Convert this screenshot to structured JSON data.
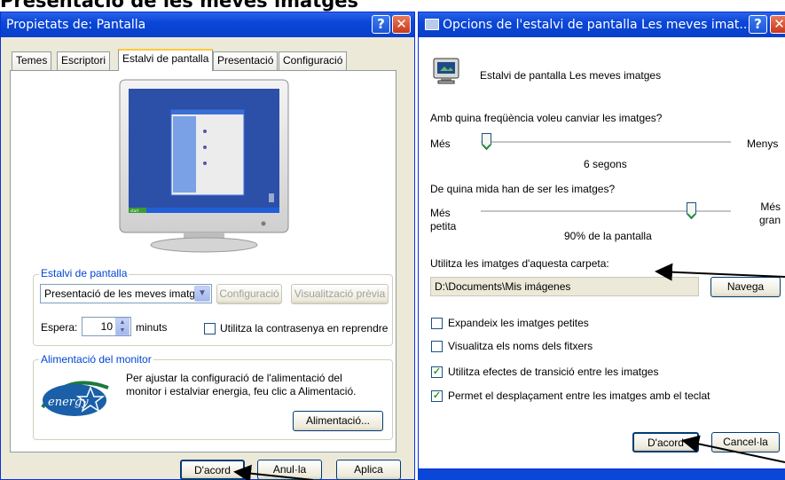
{
  "banner": {
    "title": "Presentació de les meves imatges"
  },
  "left_window": {
    "title": "Propietats de: Pantalla",
    "tabs": [
      "Temes",
      "Escriptori",
      "Estalvi de pantalla",
      "Presentació",
      "Configuració"
    ],
    "active_tab": "Estalvi de pantalla",
    "screensaver_group": {
      "label": "Estalvi de pantalla",
      "selected": "Presentació de les meves imatg",
      "settings_button": "Configuració",
      "preview_button": "Visualització prèvia",
      "wait_label": "Espera:",
      "wait_value": "10",
      "wait_unit": "minuts",
      "password_checkbox_label": "Utilitza la contrasenya en reprendre",
      "password_checked": false
    },
    "power_group": {
      "label": "Alimentació del monitor",
      "text": "Per ajustar la configuració de l'alimentació del monitor i estalviar energia, feu clic a Alimentació.",
      "button": "Alimentació...",
      "logo_text": "energy"
    },
    "preview_screen": {
      "start_label": "start"
    },
    "buttons": {
      "ok": "D'acord",
      "cancel": "Anul·la",
      "apply": "Aplica"
    }
  },
  "right_window": {
    "title": "Opcions de l'estalvi de pantalla Les meves imat...",
    "header_text": "Estalvi de pantalla Les meves imatges",
    "frequency": {
      "question": "Amb quina freqüència voleu canviar les imatges?",
      "left": "Més",
      "right": "Menys",
      "value_text": "6 segons",
      "level": 0.02
    },
    "size": {
      "question": "De quina mida han de ser les imatges?",
      "left": "Més petita",
      "right": "Més gran",
      "value_text": "90% de la pantalla",
      "level": 0.84
    },
    "folder": {
      "label": "Utilitza les imatges d'aquesta carpeta:",
      "value": "D:\\Documents\\Mis imágenes",
      "browse_button": "Navega"
    },
    "options": [
      {
        "label": "Expandeix les imatges petites",
        "checked": false
      },
      {
        "label": "Visualitza els noms dels fitxers",
        "checked": false
      },
      {
        "label": "Utilitza efectes de transició entre les imatges",
        "checked": true
      },
      {
        "label": "Permet el desplaçament entre les imatges amb el teclat",
        "checked": true
      }
    ],
    "buttons": {
      "ok": "D'acord",
      "cancel": "Cancel·la"
    }
  },
  "colors": {
    "titlebar": "#0a46d8",
    "window_bg": "#ece9d8",
    "accent_tab": "#ffc83c",
    "group_label": "#0046d5"
  },
  "icons": [
    "help-icon",
    "close-icon",
    "display-icon",
    "energy-star-logo",
    "monitor-preview",
    "spin-arrows-icon",
    "dropdown-arrow-icon"
  ]
}
